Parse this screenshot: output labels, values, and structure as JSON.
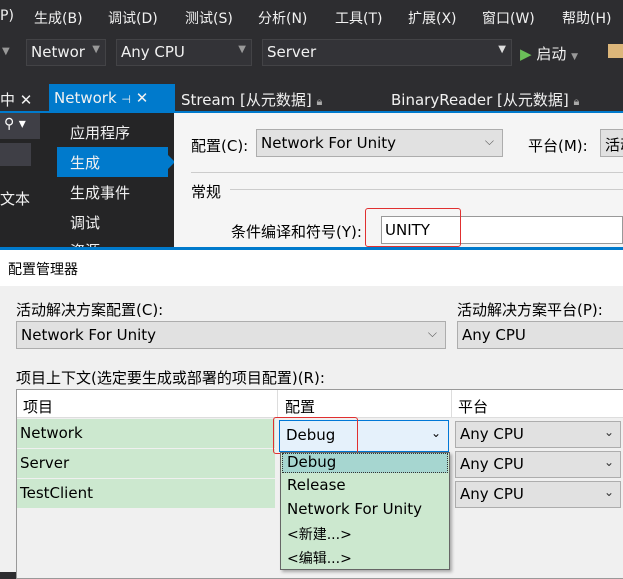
{
  "menu": [
    "P)",
    "生成(B)",
    "调试(D)",
    "测试(S)",
    "分析(N)",
    "工具(T)",
    "扩展(X)",
    "窗口(W)",
    "帮助(H)"
  ],
  "toolbar": {
    "project": "Networ",
    "platform": "Any CPU",
    "startup": "Server",
    "start_label": "启动"
  },
  "tabs": {
    "left_panel": "中",
    "active": "Network",
    "t2": "Stream [从元数据]",
    "t3": "BinaryReader [从元数据]"
  },
  "left_panel": {
    "text": "文本"
  },
  "nav": [
    "应用程序",
    "生成",
    "生成事件",
    "调试",
    "资源"
  ],
  "props": {
    "config_label": "配置(C):",
    "config_value": "Network For Unity",
    "platform_label": "平台(M):",
    "platform_value": "活动",
    "section": "常规",
    "symbols_label": "条件编译和符号(Y):",
    "symbols_value": "UNITY"
  },
  "dialog": {
    "title": "配置管理器",
    "sol_config_label": "活动解决方案配置(C):",
    "sol_config_value": "Network For Unity",
    "sol_platform_label": "活动解决方案平台(P):",
    "sol_platform_value": "Any CPU",
    "context_label": "项目上下文(选定要生成或部署的项目配置)(R):",
    "columns": [
      "项目",
      "配置",
      "平台"
    ],
    "rows": [
      {
        "project": "Network",
        "config": "Debug",
        "platform": "Any CPU"
      },
      {
        "project": "Server",
        "platform": "Any CPU"
      },
      {
        "project": "TestClient",
        "platform": "Any CPU"
      }
    ],
    "dropdown": [
      "Debug",
      "Release",
      "Network For Unity",
      "<新建...>",
      "<编辑...>"
    ]
  }
}
